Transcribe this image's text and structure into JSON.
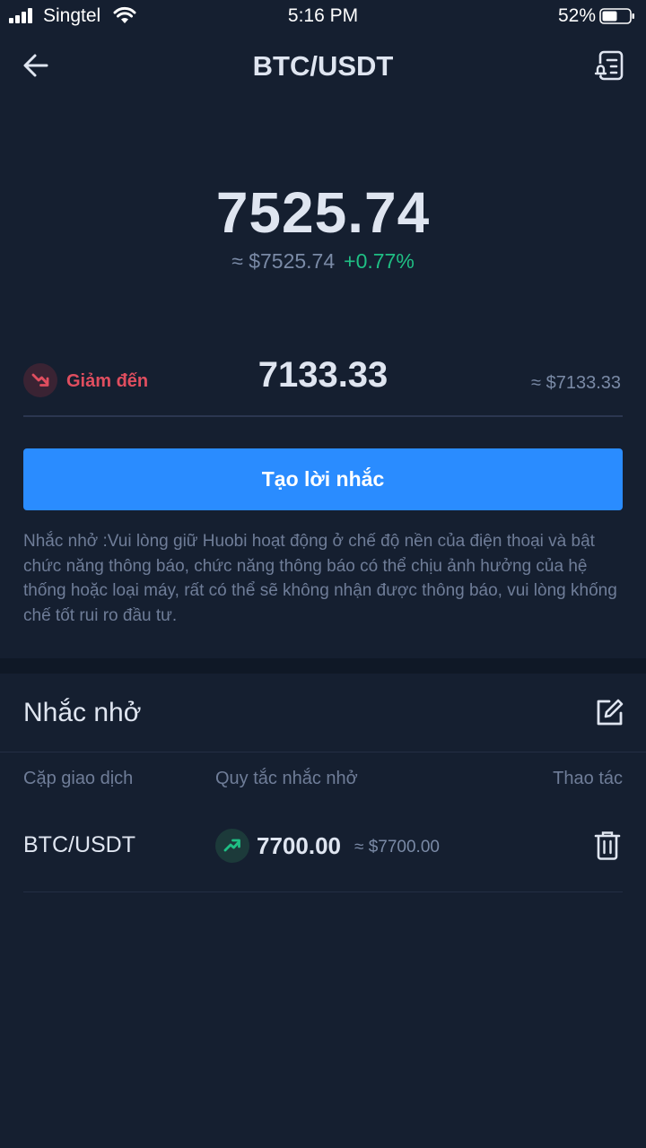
{
  "status_bar": {
    "carrier": "Singtel",
    "time": "5:16 PM",
    "battery": "52%"
  },
  "nav": {
    "title": "BTC/USDT",
    "back_icon": "back-arrow-icon",
    "right_icon": "alert-list-icon"
  },
  "price": {
    "value": "7525.74",
    "approx": "≈ $7525.74",
    "change": "+0.77%"
  },
  "condition": {
    "label": "Giảm đến",
    "value": "7133.33",
    "approx": "≈ $7133.33",
    "icon": "trend-down-icon"
  },
  "create_button": {
    "label": "Tạo lời nhắc"
  },
  "notice": "Nhắc nhở :Vui lòng giữ Huobi hoạt động ở chế độ nền của điện thoại và bật chức năng thông báo, chức năng thông báo có thể chịu ảnh hưởng của hệ thống hoặc loại máy, rất có thể sẽ không nhận được thông báo, vui lòng khống chế tốt rui ro đầu tư.",
  "reminders": {
    "title": "Nhắc nhở",
    "columns": {
      "pair": "Cặp giao dịch",
      "rule": "Quy tắc nhắc nhở",
      "action": "Thao tác"
    },
    "rows": [
      {
        "pair": "BTC/USDT",
        "value": "7700.00",
        "approx": "≈ $7700.00",
        "icon": "trend-up-icon"
      }
    ]
  },
  "colors": {
    "background": "#151f30",
    "accent": "#2a8cff",
    "up": "#1fbf84",
    "down": "#e04e5f"
  }
}
